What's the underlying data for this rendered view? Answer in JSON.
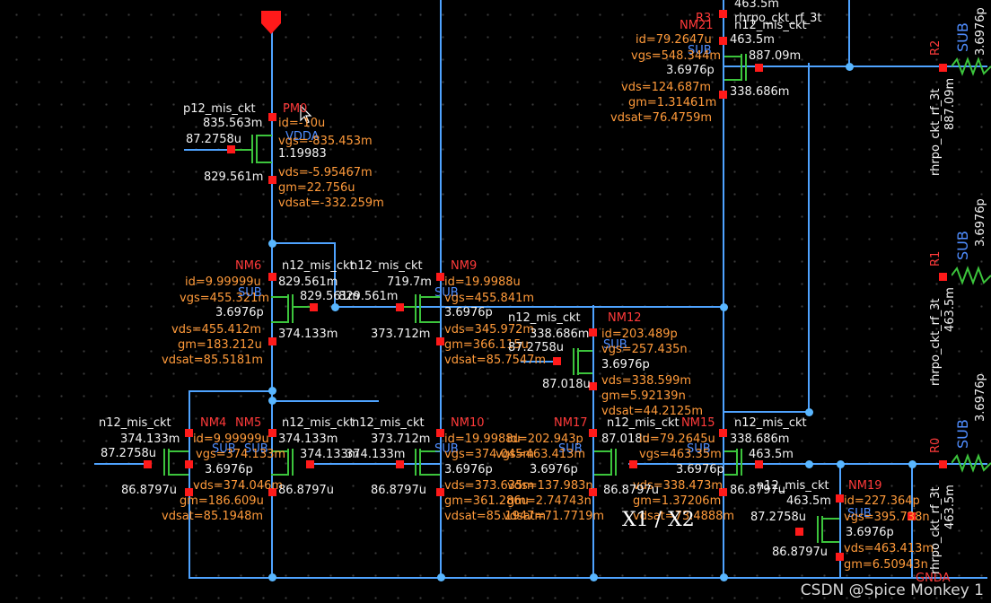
{
  "canvas": {
    "background": "#000000",
    "wire_color": "#4fa3ff",
    "pin_color": "#ff1a1a",
    "device_color": "#3cc43c",
    "param_color": "#ff9a3a",
    "name_color": "#ff3a3a",
    "model_color": "#f2f2f2"
  },
  "pm0": {
    "model": "p12_mis_ckt",
    "name": "PM0",
    "node_gate": "835.563m",
    "id": "id=-10u",
    "pin": "87.2758u",
    "body": "VDDA",
    "vgs": "vgs=-835.453m",
    "val": "1.19983",
    "node_drain": "829.561m",
    "vds": "vds=-5.95467m",
    "gm": "gm=22.756u",
    "vdsat": "vdsat=-332.259m"
  },
  "nm6": {
    "name": "NM6",
    "model_l": "n12_mis_ckt",
    "model_r": "n12_mis_ckt",
    "id": "id=9.99999u",
    "node_top": "829.561m",
    "node_gate_r": "829.561m",
    "node_gate_l": "829.561m",
    "vgs": "vgs=455.321m",
    "sub": "SUB",
    "cap": "3.6976p",
    "vds": "vds=455.412m",
    "node_src": "374.133m",
    "gm": "gm=183.212u",
    "vdsat": "vdsat=85.5181m"
  },
  "nm9": {
    "name": "NM9",
    "node_top": "719.7m",
    "id": "id=19.9988u",
    "sub": "SUB",
    "vgs": "vgs=455.841m",
    "node_l": "373.712m",
    "cap": "3.6976p",
    "vds": "vds=345.972m",
    "gm": "gm=366.115u",
    "vdsat": "vdsat=85.7547m"
  },
  "nm12": {
    "model": "n12_mis_ckt",
    "name": "NM12",
    "node_top": "338.686m",
    "id": "id=203.489p",
    "pin": "87.2758u",
    "sub": "SUB",
    "vgs": "vgs=257.435n",
    "cap": "3.6976p",
    "node_bot": "87.018u",
    "vds": "vds=338.599m",
    "gm": "gm=5.92139n",
    "vdsat": "vdsat=44.2125m"
  },
  "nm4": {
    "model_l": "n12_mis_ckt",
    "name": "NM4",
    "name2": "NM5",
    "model_r": "n12_mis_ckt",
    "node_l": "374.133m",
    "id": "id=9.99999u",
    "node_r": "374.133m",
    "sub": "SUB",
    "sub2": "SUB",
    "pin_l": "87.2758u",
    "vgs": "vgs=374.133m",
    "node_mid": "374.133m",
    "cap": "3.6976p",
    "vds": "vds=374.046m",
    "node_bot_l": "86.8797u",
    "node_bot_r": "86.8797u",
    "gm": "gm=186.609u",
    "vdsat": "vdsat=85.1948m"
  },
  "nm10": {
    "model": "n12_mis_ckt",
    "name": "NM10",
    "node_top": "373.712m",
    "id": "id=19.9988u",
    "node_gate": "374.133m",
    "sub": "SUB",
    "vgs": "vgs=374.045m",
    "cap": "3.6976p",
    "node_bot": "86.8797u",
    "vds": "vds=373.635m",
    "gm": "gm=361.286u",
    "vdsat": "vdsat=85.1947m"
  },
  "nm17": {
    "name": "NM17",
    "model": "n12_mis_ckt",
    "name2": "NM15",
    "model2": "n12_mis_ckt",
    "id": "id=202.943p",
    "node_mid": "87.018u",
    "id2": "id=79.2645u",
    "node_r": "338.686m",
    "sub": "SUB",
    "sub2": "SUB",
    "vgs": "vgs=463.413m",
    "vgs2": "vgs=463.35m",
    "node_463": "463.5m",
    "cap": "3.6976p",
    "cap2": "3.6976p",
    "vds": "vds=137.983n",
    "vds2": "vds=338.473m",
    "node_bot": "86.8797u",
    "node_bot2": "86.8797u",
    "gm": "gm=2.74743n",
    "gm2": "gm=1.37206m",
    "vdsat": "vdsat=71.7719m",
    "vdsat2": "vdsat=73.4888m"
  },
  "nm21": {
    "name": "NM21",
    "model": "n12_mis_ckt",
    "id": "id=79.2647u",
    "node": "463.5m",
    "sub": "SUB",
    "vgs": "vgs=548.344m",
    "node_r": "887.09m",
    "cap": "3.6976p",
    "vds": "vds=124.687m",
    "node_bot": "338.686m",
    "gm": "gm=1.31461m",
    "vdsat": "vdsat=76.4759m",
    "r3_name": "R3",
    "r3_model": "rhrpo_ckt_rf_3t",
    "top_node": "463.5m"
  },
  "nm19": {
    "model": "n12_mis_ckt",
    "name": "NM19",
    "node": "463.5m",
    "id": "id=227.364p",
    "pin": "87.2758u",
    "sub": "SUB",
    "vgs": "vgs=395.738n",
    "cap": "3.6976p",
    "node_bot": "86.8797u",
    "vds": "vds=463.413m",
    "gm": "gm=6.50943n",
    "net": "GNDA"
  },
  "resistors": [
    {
      "name": "R2",
      "sub": "SUB",
      "model": "rhrpo_ckt_rf_3t",
      "node": "887.09m",
      "cap": "3.6976p"
    },
    {
      "name": "R1",
      "sub": "SUB",
      "model": "rhrpo_ckt_rf_3t",
      "node": "463.5m",
      "cap": "3.6976p"
    },
    {
      "name": "R0",
      "sub": "SUB",
      "model": "rhrpo_ckt_rf_3t",
      "node": "463.5m",
      "cap": "3.6976p"
    }
  ],
  "overlay": {
    "handwritten": "X1 / X2",
    "watermark": "CSDN @Spice Monkey 1"
  }
}
